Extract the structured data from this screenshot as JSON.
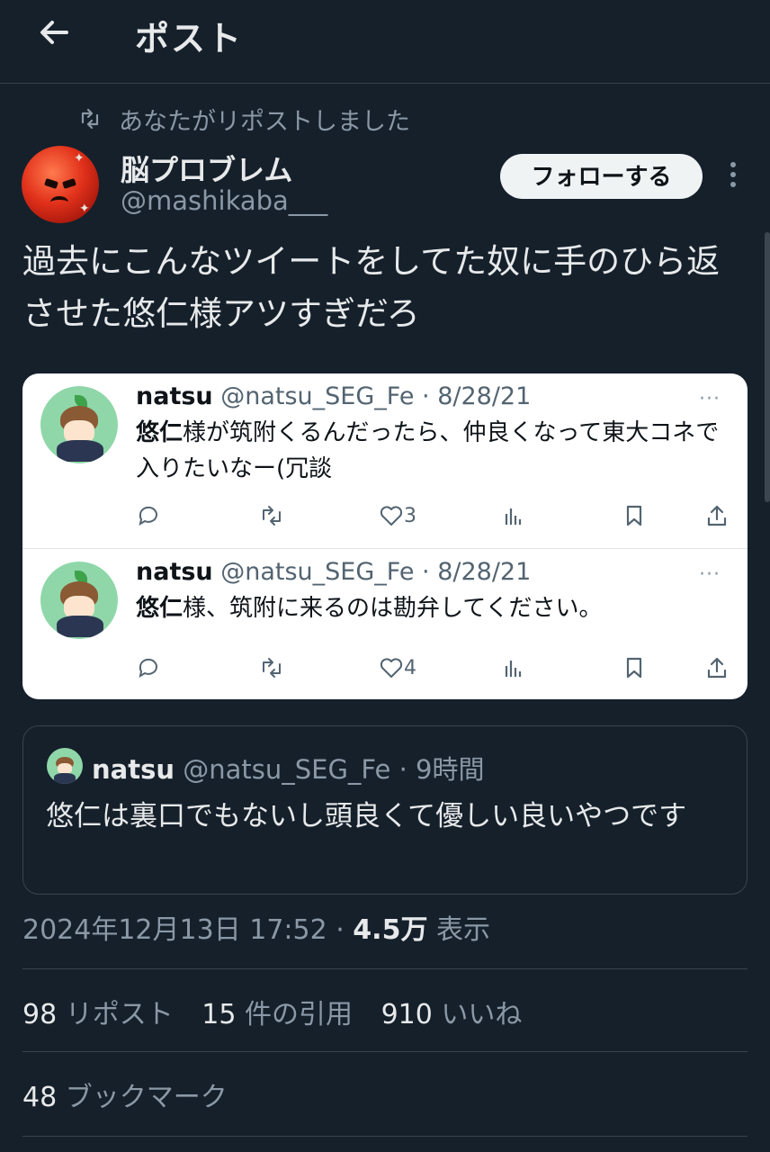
{
  "header": {
    "title": "ポスト"
  },
  "repost": {
    "label": "あなたがリポストしました"
  },
  "author": {
    "name": "脳プロブレム",
    "handle": "@mashikaba___"
  },
  "follow_label": "フォローする",
  "tweet": {
    "text": "過去にこんなツイートをしてた奴に手のひら返させた悠仁様アツすぎだろ"
  },
  "image_card": {
    "posts": [
      {
        "name": "natsu",
        "meta": "@natsu_SEG_Fe · 8/28/21",
        "bold": "悠仁",
        "text": "様が筑附くるんだったら、仲良くなって東大コネで入りたいなー(冗談",
        "like_count": "3",
        "more": "···"
      },
      {
        "name": "natsu",
        "meta": "@natsu_SEG_Fe · 8/28/21",
        "bold": "悠仁",
        "text": "様、筑附に来るのは勘弁してください。",
        "like_count": "4",
        "more": "···"
      }
    ]
  },
  "quote": {
    "name": "natsu",
    "meta": "@natsu_SEG_Fe · 9時間",
    "text": "悠仁は裏口でもないし頭良くて優しい良いやつです"
  },
  "timestamp": {
    "date": "2024年12月13日 17:52 · ",
    "views": "4.5万",
    "views_label": " 表示"
  },
  "stats": {
    "reposts": "98",
    "reposts_label": " リポスト",
    "quotes": "15",
    "quotes_label": " 件の引用",
    "likes": "910",
    "likes_label": " いいね",
    "bookmarks": "48",
    "bookmarks_label": " ブックマーク"
  },
  "icons": {
    "back": "arrow-left-icon",
    "repost": "repost-icon",
    "more": "more-vertical-icon",
    "reply": "reply-icon",
    "retweet": "retweet-icon",
    "like": "heart-icon",
    "views": "analytics-icon",
    "bookmark": "bookmark-icon",
    "share": "share-icon"
  },
  "colors": {
    "background": "#15202b",
    "text": "#e7e9ea",
    "muted": "#8b98a5",
    "border": "#38444d"
  }
}
